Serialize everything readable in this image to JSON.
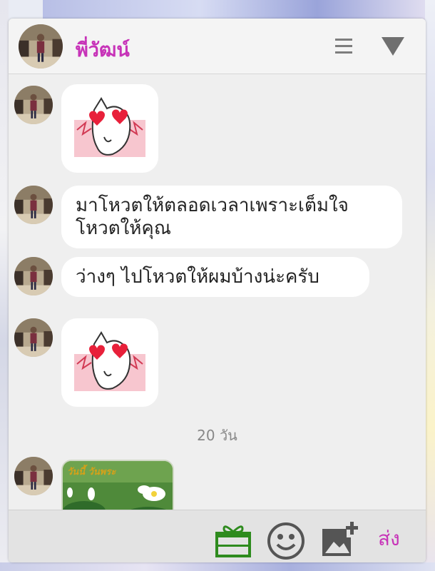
{
  "header": {
    "contact_name": "พี่วัฒน์",
    "menu_icon": "hamburger-menu-icon",
    "collapse_icon": "triangle-down-icon"
  },
  "messages": [
    {
      "type": "sticker",
      "sticker": "heart-eyes-cat-sticker"
    },
    {
      "type": "text",
      "lines": [
        "มาโหวตให้ตลอดเวลาเพราะเต็มใจ",
        "โหวตให้คุณ"
      ]
    },
    {
      "type": "text",
      "lines": [
        "ว่างๆ ไปโหวตให้ผมบ้างน่ะครับ"
      ]
    },
    {
      "type": "sticker",
      "sticker": "heart-eyes-cat-sticker"
    }
  ],
  "date_divider": "20 วัน",
  "image_message": {
    "caption": "วันนี้ วันพระ",
    "image": "white-lotus-photo"
  },
  "footer": {
    "gift_icon": "gift-icon",
    "emoji_icon": "smiley-icon",
    "photo_icon": "add-photo-icon",
    "send_label": "ส่ง"
  },
  "colors": {
    "accent": "#c733b8",
    "gift_green": "#2e8b1e",
    "bubble": "#ffffff",
    "panel": "#efefef"
  }
}
